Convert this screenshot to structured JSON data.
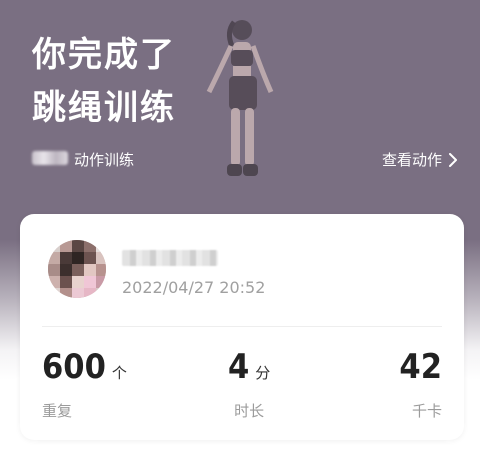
{
  "header": {
    "title_line1": "你完成了",
    "title_line2": "跳绳训练",
    "action_label": "动作训练",
    "view_actions": "查看动作"
  },
  "record": {
    "timestamp": "2022/04/27 20:52"
  },
  "stats": [
    {
      "value": "600",
      "unit": "个",
      "label": "重复"
    },
    {
      "value": "4",
      "unit": "分",
      "label": "时长"
    },
    {
      "value": "42",
      "unit": "",
      "label": "千卡"
    }
  ],
  "icons": {
    "view_actions": "chevron-right-icon"
  },
  "colors": {
    "hero_bg": "#7a6f82",
    "card_bg": "#ffffff"
  }
}
